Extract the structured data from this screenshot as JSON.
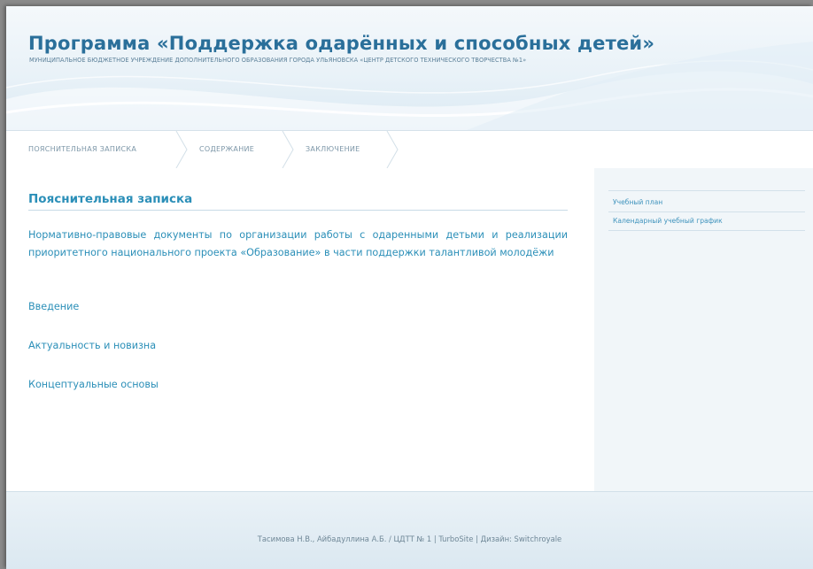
{
  "header": {
    "title": "Программа «Поддержка одарённых и способных детей»",
    "subtitle": "МУНИЦИПАЛЬНОЕ БЮДЖЕТНОЕ УЧРЕЖДЕНИЕ ДОПОЛНИТЕЛЬНОГО ОБРАЗОВАНИЯ ГОРОДА УЛЬЯНОВСКА «ЦЕНТР ДЕТСКОГО ТЕХНИЧЕСКОГО ТВОРЧЕСТВА №1»"
  },
  "nav": {
    "items": [
      {
        "label": "ПОЯСНИТЕЛЬНАЯ ЗАПИСКА"
      },
      {
        "label": "СОДЕРЖАНИЕ"
      },
      {
        "label": "ЗАКЛЮЧЕНИЕ"
      }
    ]
  },
  "main": {
    "heading": "Пояснительная записка",
    "links": [
      "Нормативно-правовые документы по организации работы с одаренными детьми и реализации приоритетного национального проекта «Образование» в части поддержки талантливой молодёжи",
      "Введение",
      "Актуальность и новизна",
      "Концептуальные основы"
    ]
  },
  "sidebar": {
    "links": [
      "Учебный план",
      "Календарный учебный график"
    ]
  },
  "footer": {
    "text": "Тасимова Н.В., Айбадуллина А.Б. / ЦДТТ № 1 | TurboSite | Дизайн: Switchroyale"
  },
  "colors": {
    "accent": "#2b8fb8",
    "title": "#2a6f9a",
    "page_bg": "#ffffff",
    "sidebar_bg": "#f1f6f9"
  }
}
